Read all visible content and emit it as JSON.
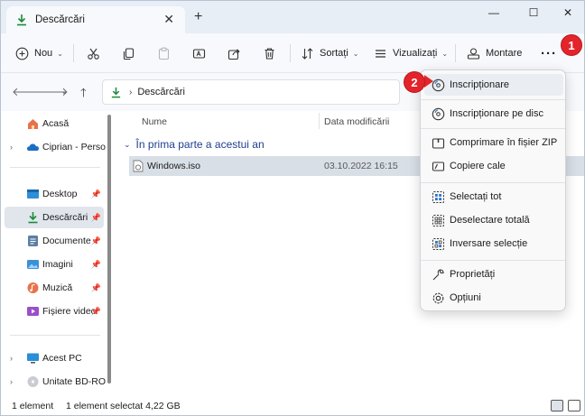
{
  "window": {
    "tab_title": "Descărcări",
    "new_tab": "+",
    "minimize": "—",
    "maximize": "☐",
    "close": "✕"
  },
  "toolbar": {
    "new_label": "Nou",
    "sort_label": "Sortați",
    "view_label": "Vizualizați",
    "mount_label": "Montare",
    "more_label": "···"
  },
  "address": {
    "current_folder": "Descărcări"
  },
  "sidebar": {
    "items": [
      {
        "label": "Acasă"
      },
      {
        "label": "Ciprian - Person"
      },
      {
        "label": "Desktop"
      },
      {
        "label": "Descărcări"
      },
      {
        "label": "Documente"
      },
      {
        "label": "Imagini"
      },
      {
        "label": "Muzică"
      },
      {
        "label": "Fișiere video"
      },
      {
        "label": "Acest PC"
      },
      {
        "label": "Unitate BD-ROM"
      }
    ]
  },
  "content": {
    "col_name": "Nume",
    "col_date": "Data modificării",
    "group_label": "În prima parte a acestui an",
    "file": {
      "name": "Windows.iso",
      "date": "03.10.2022 16:15"
    }
  },
  "context_menu": {
    "items": [
      {
        "label": "Inscripționare"
      },
      {
        "label": "Inscripționare pe disc"
      },
      {
        "label": "Comprimare în fișier ZIP"
      },
      {
        "label": "Copiere cale"
      },
      {
        "label": "Selectați tot"
      },
      {
        "label": "Deselectare totală"
      },
      {
        "label": "Inversare selecție"
      },
      {
        "label": "Proprietăți"
      },
      {
        "label": "Opțiuni"
      }
    ]
  },
  "status": {
    "count": "1 element",
    "selection": "1 element selectat  4,22 GB"
  },
  "callouts": {
    "first": "1",
    "second": "2"
  },
  "colors": {
    "accent": "#1a8a3a",
    "callout": "#e3242b",
    "group_text": "#1f3f8f"
  }
}
